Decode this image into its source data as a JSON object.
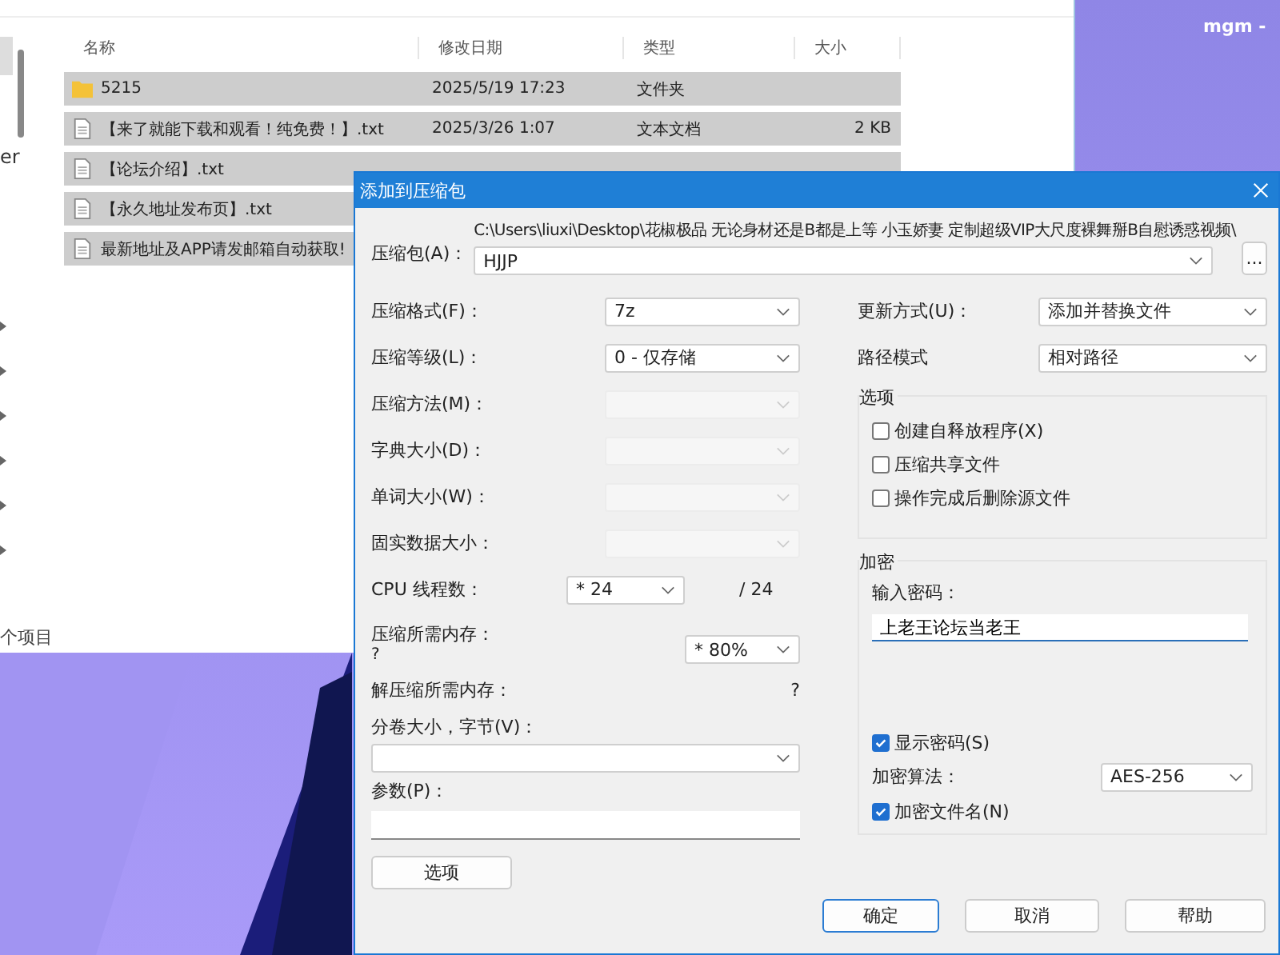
{
  "desktop": {
    "label": "mgm -"
  },
  "explorer": {
    "nav_text": "er",
    "columns": [
      "名称",
      "修改日期",
      "类型",
      "大小"
    ],
    "rows": [
      {
        "kind": "folder",
        "name": "5215",
        "date": "2025/5/19 17:23",
        "type": "文件夹",
        "selected": true
      },
      {
        "kind": "file",
        "name": "【来了就能下载和观看！纯免费！】.txt",
        "date": "2025/3/26 1:07",
        "type": "文本文档",
        "size": "2 KB",
        "selected": true
      },
      {
        "kind": "file",
        "name": "【论坛介绍】.txt",
        "selected": true
      },
      {
        "kind": "file",
        "name": "【永久地址发布页】.txt",
        "selected": true
      },
      {
        "kind": "file",
        "name": "最新地址及APP请发邮箱自动获取!",
        "selected": true
      }
    ],
    "status": "个项目"
  },
  "dialog": {
    "title": "添加到压缩包",
    "archive": {
      "label": "压缩包(A)：",
      "path": "C:\\Users\\liuxi\\Desktop\\花椒极品 无论身材还是B都是上等 小玉娇妻 定制超级VIP大尺度裸舞掰B自慰诱惑视频\\",
      "value": "HJJP",
      "browse": "..."
    },
    "left_fields": [
      {
        "label": "压缩格式(F)：",
        "value": "7z",
        "disabled": false
      },
      {
        "label": "压缩等级(L)：",
        "value": "0 - 仅存储",
        "disabled": false
      },
      {
        "label": "压缩方法(M)：",
        "disabled": true
      },
      {
        "label": "字典大小(D)：",
        "disabled": true
      },
      {
        "label": "单词大小(W)：",
        "disabled": true
      },
      {
        "label": "固实数据大小：",
        "disabled": true
      }
    ],
    "cpu": {
      "label": "CPU 线程数：",
      "value": "* 24",
      "max": "/ 24"
    },
    "memory": {
      "label": "压缩所需内存：",
      "note": "?",
      "value": "* 80%"
    },
    "decompress": {
      "label": "解压缩所需内存：",
      "value": "?"
    },
    "volume": {
      "label": "分卷大小，字节(V)："
    },
    "params": {
      "label": "参数(P)："
    },
    "options_button": "选项",
    "right_fields": [
      {
        "label": "更新方式(U)：",
        "value": "添加并替换文件"
      },
      {
        "label": "路径模式",
        "value": "相对路径"
      }
    ],
    "options": {
      "title": "选项",
      "items": [
        {
          "label": "创建自释放程序(X)",
          "checked": false
        },
        {
          "label": "压缩共享文件",
          "checked": false
        },
        {
          "label": "操作完成后删除源文件",
          "checked": false
        }
      ]
    },
    "encryption": {
      "title": "加密",
      "password_label": "输入密码：",
      "password": "上老王论坛当老王",
      "show_password": {
        "label": "显示密码(S)",
        "checked": true
      },
      "method_label": "加密算法：",
      "method": "AES-256",
      "encrypt_names": {
        "label": "加密文件名(N)",
        "checked": true
      }
    },
    "buttons": [
      {
        "label": "确定",
        "default": true
      },
      {
        "label": "取消",
        "default": false
      },
      {
        "label": "帮助",
        "default": false
      }
    ]
  }
}
